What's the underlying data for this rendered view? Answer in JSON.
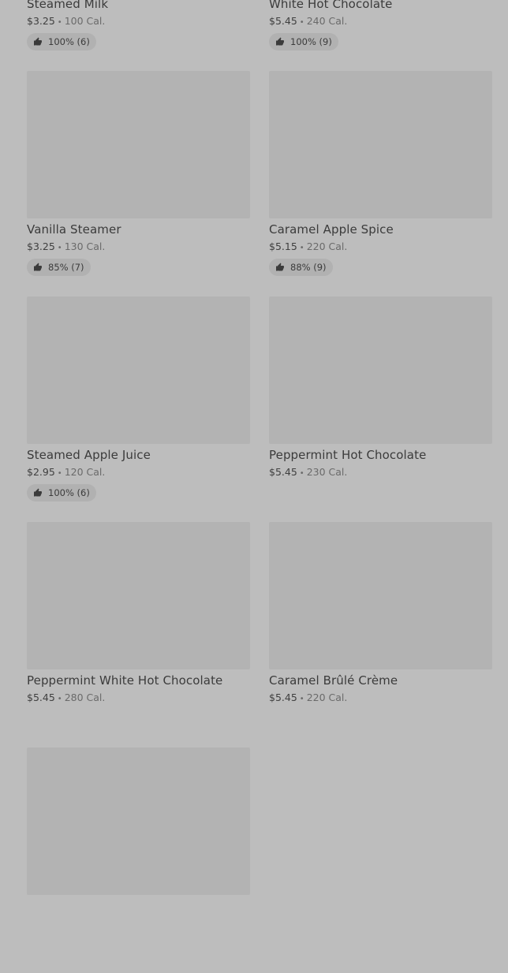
{
  "items": [
    {
      "name": "Steamed Milk",
      "price": "$3.25",
      "separator": "•",
      "calories": "100 Cal.",
      "rating": "100% (6)"
    },
    {
      "name": "White Hot Chocolate",
      "price": "$5.45",
      "separator": "•",
      "calories": "240 Cal.",
      "rating": "100% (9)"
    },
    {
      "name": "Vanilla Steamer",
      "price": "$3.25",
      "separator": "•",
      "calories": "130 Cal.",
      "rating": "85% (7)"
    },
    {
      "name": "Caramel Apple Spice",
      "price": "$5.15",
      "separator": "•",
      "calories": "220 Cal.",
      "rating": "88% (9)"
    },
    {
      "name": "Steamed Apple Juice",
      "price": "$2.95",
      "separator": "•",
      "calories": "120 Cal.",
      "rating": "100% (6)"
    },
    {
      "name": "Peppermint Hot Chocolate",
      "price": "$5.45",
      "separator": "•",
      "calories": "230 Cal.",
      "rating": null
    },
    {
      "name": "Peppermint White Hot Chocolate",
      "price": "$5.45",
      "separator": "•",
      "calories": "280 Cal.",
      "rating": null
    },
    {
      "name": "Caramel Brûlé Crème",
      "price": "$5.45",
      "separator": "•",
      "calories": "220 Cal.",
      "rating": null
    },
    {
      "name": "",
      "price": "",
      "separator": "",
      "calories": "",
      "rating": null
    }
  ],
  "icons": {
    "rating": "thumbs-up-icon"
  }
}
